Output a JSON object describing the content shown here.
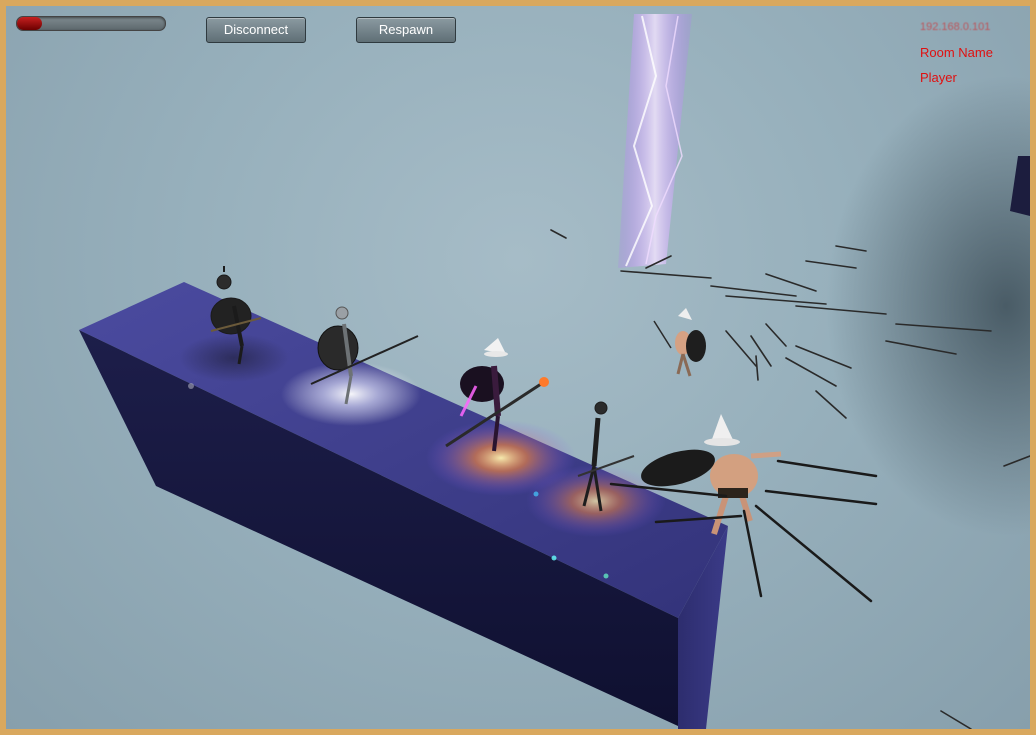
{
  "hud": {
    "health_fraction": 0.17,
    "disconnect_label": "Disconnect",
    "respawn_label": "Respawn"
  },
  "net_info": {
    "ip": "192.168.0.101",
    "room_name": "Room Name",
    "player": "Player"
  },
  "colors": {
    "frame": "#d9a85e",
    "sky": "#9fb6c1",
    "platform_top": "#4a4a9a",
    "platform_side": "#15163a",
    "info_text": "#e01010",
    "beam": "#d9b3ff"
  }
}
